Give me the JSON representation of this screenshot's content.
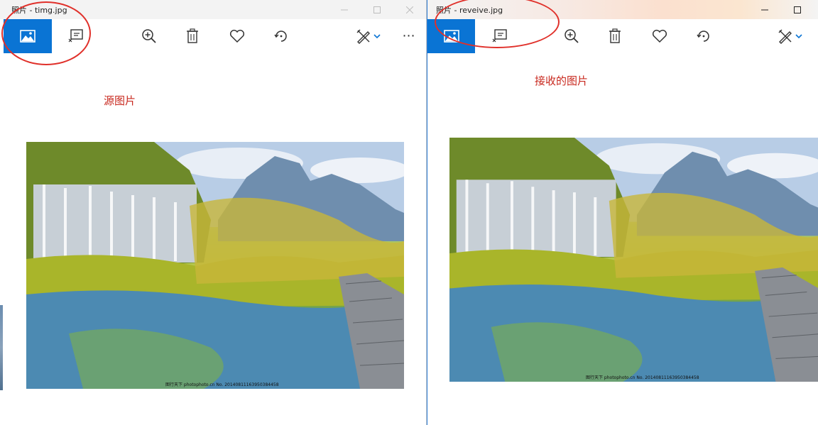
{
  "left_window": {
    "title": "照片 - timg.jpg",
    "label": "源图片",
    "watermark": "图行天下 photophoto.cn No. 20140811163950384458"
  },
  "right_window": {
    "title": "照片 - reveive.jpg",
    "label": "接收的图片",
    "watermark": "图行天下 photophoto.cn No. 20140811163950384458"
  },
  "toolbar": {
    "more_label": "⋯"
  },
  "colors": {
    "accent": "#0a74d4",
    "annotation_red": "#e0302a"
  },
  "icons": [
    "image-icon",
    "slideshow-icon",
    "zoom-in-icon",
    "delete-icon",
    "favorite-heart-icon",
    "rotate-icon",
    "edit-create-icon",
    "chevron-down-icon",
    "more-icon"
  ]
}
